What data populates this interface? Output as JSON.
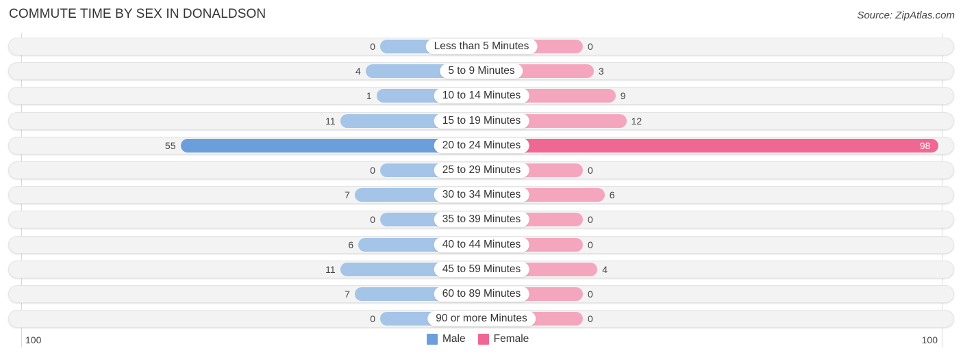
{
  "header": {
    "title": "COMMUTE TIME BY SEX IN DONALDSON",
    "source": "Source: ZipAtlas.com"
  },
  "colors": {
    "male": "#a4c4e8",
    "male_highlight": "#6a9fdc",
    "female": "#f5a6bf",
    "female_highlight": "#f06793",
    "track": "#f3f3f3"
  },
  "chart_data": {
    "type": "bar",
    "orientation": "horizontal-diverging",
    "title": "COMMUTE TIME BY SEX IN DONALDSON",
    "categories": [
      "Less than 5 Minutes",
      "5 to 9 Minutes",
      "10 to 14 Minutes",
      "15 to 19 Minutes",
      "20 to 24 Minutes",
      "25 to 29 Minutes",
      "30 to 34 Minutes",
      "35 to 39 Minutes",
      "40 to 44 Minutes",
      "45 to 59 Minutes",
      "60 to 89 Minutes",
      "90 or more Minutes"
    ],
    "series": [
      {
        "name": "Male",
        "values": [
          0,
          4,
          1,
          11,
          55,
          0,
          7,
          0,
          6,
          11,
          7,
          0
        ]
      },
      {
        "name": "Female",
        "values": [
          0,
          3,
          9,
          12,
          98,
          0,
          6,
          0,
          0,
          4,
          0,
          0
        ]
      }
    ],
    "axis": {
      "left_label": "100",
      "right_label": "100",
      "max": 100
    },
    "legend": {
      "position": "bottom-center",
      "items": [
        "Male",
        "Female"
      ]
    },
    "grid": false
  }
}
